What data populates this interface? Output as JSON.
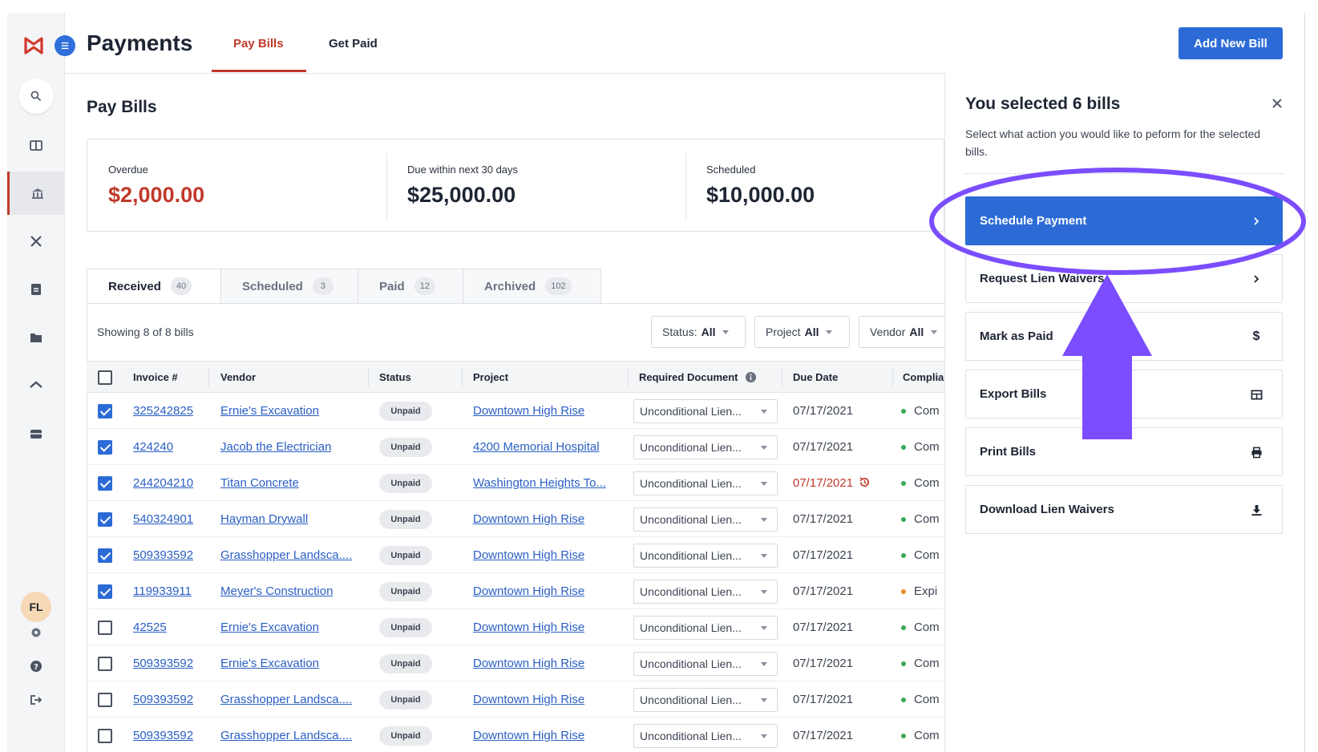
{
  "app": {
    "title": "Payments"
  },
  "header": {
    "tabs": [
      {
        "label": "Pay Bills",
        "active": true
      },
      {
        "label": "Get Paid",
        "active": false
      }
    ],
    "add_button": "Add New Bill"
  },
  "sidebar": {
    "icons": [
      "search-icon",
      "dashboard-icon",
      "bank-icon",
      "tools-icon",
      "document-icon",
      "folder-icon",
      "home-icon",
      "inbox-icon",
      "settings-icon",
      "help-icon",
      "logout-icon"
    ],
    "avatar": "FL"
  },
  "page": {
    "title": "Pay Bills"
  },
  "summary": [
    {
      "label": "Overdue",
      "value": "$2,000.00",
      "color": "#c0392b"
    },
    {
      "label": "Due within next 30 days",
      "value": "$25,000.00",
      "color": "#1d2533"
    },
    {
      "label": "Scheduled",
      "value": "$10,000.00",
      "color": "#1d2533"
    }
  ],
  "tabs": [
    {
      "label": "Received",
      "count": "40",
      "active": true
    },
    {
      "label": "Scheduled",
      "count": "3",
      "active": false
    },
    {
      "label": "Paid",
      "count": "12",
      "active": false
    },
    {
      "label": "Archived",
      "count": "102",
      "active": false
    }
  ],
  "list": {
    "showing": "Showing 8 of 8 bills",
    "filters": [
      {
        "prefix": "Status:",
        "value": "All"
      },
      {
        "prefix": "Project",
        "value": "All"
      },
      {
        "prefix": "Vendor",
        "value": "All"
      }
    ]
  },
  "table": {
    "columns": [
      "Invoice #",
      "Vendor",
      "Status",
      "Project",
      "Required Document",
      "Due Date",
      "Complia"
    ],
    "rows": [
      {
        "checked": true,
        "invoice": "325242825",
        "vendor": "Ernie's Excavation",
        "status": "Unpaid",
        "project": "Downtown High Rise",
        "document": "Unconditional Lien...",
        "due": "07/17/2021",
        "overdue": false,
        "compliance": "Com",
        "compliance_color": "green"
      },
      {
        "checked": true,
        "invoice": "424240",
        "vendor": "Jacob the Electrician",
        "status": "Unpaid",
        "project": "4200 Memorial Hospital",
        "document": "Unconditional Lien...",
        "due": "07/17/2021",
        "overdue": false,
        "compliance": "Com",
        "compliance_color": "green"
      },
      {
        "checked": true,
        "invoice": "244204210",
        "vendor": "Titan Concrete",
        "status": "Unpaid",
        "project": "Washington Heights To...",
        "document": "Unconditional Lien...",
        "due": "07/17/2021",
        "overdue": true,
        "compliance": "Com",
        "compliance_color": "green"
      },
      {
        "checked": true,
        "invoice": "540324901",
        "vendor": "Hayman Drywall",
        "status": "Unpaid",
        "project": "Downtown High Rise",
        "document": "Unconditional Lien...",
        "due": "07/17/2021",
        "overdue": false,
        "compliance": "Com",
        "compliance_color": "green"
      },
      {
        "checked": true,
        "invoice": "509393592",
        "vendor": "Grasshopper Landsca....",
        "status": "Unpaid",
        "project": "Downtown High Rise",
        "document": "Unconditional Lien...",
        "due": "07/17/2021",
        "overdue": false,
        "compliance": "Com",
        "compliance_color": "green"
      },
      {
        "checked": true,
        "invoice": "119933911",
        "vendor": "Meyer's Construction",
        "status": "Unpaid",
        "project": "Downtown High Rise",
        "document": "Unconditional Lien...",
        "due": "07/17/2021",
        "overdue": false,
        "compliance": "Expi",
        "compliance_color": "orange"
      },
      {
        "checked": false,
        "invoice": "42525",
        "vendor": "Ernie's Excavation",
        "status": "Unpaid",
        "project": "Downtown High Rise",
        "document": "Unconditional Lien...",
        "due": "07/17/2021",
        "overdue": false,
        "compliance": "Com",
        "compliance_color": "green"
      },
      {
        "checked": false,
        "invoice": "509393592",
        "vendor": "Ernie's Excavation",
        "status": "Unpaid",
        "project": "Downtown High Rise",
        "document": "Unconditional Lien...",
        "due": "07/17/2021",
        "overdue": false,
        "compliance": "Com",
        "compliance_color": "green"
      },
      {
        "checked": false,
        "invoice": "509393592",
        "vendor": "Grasshopper Landsca....",
        "status": "Unpaid",
        "project": "Downtown High Rise",
        "document": "Unconditional Lien...",
        "due": "07/17/2021",
        "overdue": false,
        "compliance": "Com",
        "compliance_color": "green"
      },
      {
        "checked": false,
        "invoice": "509393592",
        "vendor": "Grasshopper Landsca....",
        "status": "Unpaid",
        "project": "Downtown High Rise",
        "document": "Unconditional Lien...",
        "due": "07/17/2021",
        "overdue": false,
        "compliance": "Com",
        "compliance_color": "green"
      }
    ]
  },
  "panel": {
    "title": "You selected 6 bills",
    "description": "Select what action you would like to peform for the selected bills.",
    "actions": [
      {
        "label": "Schedule Payment",
        "icon": "chevron-right-icon",
        "primary": true
      },
      {
        "label": "Request Lien Waivers",
        "icon": "chevron-right-icon",
        "primary": false
      },
      {
        "label": "Mark as Paid",
        "icon": "dollar-icon",
        "primary": false
      },
      {
        "label": "Export Bills",
        "icon": "table-icon",
        "primary": false
      },
      {
        "label": "Print Bills",
        "icon": "printer-icon",
        "primary": false
      },
      {
        "label": "Download Lien Waivers",
        "icon": "download-icon",
        "primary": false
      }
    ]
  },
  "colors": {
    "accent": "#c0392b",
    "primary": "#2c6bd6",
    "annotation": "#7b4dff"
  }
}
